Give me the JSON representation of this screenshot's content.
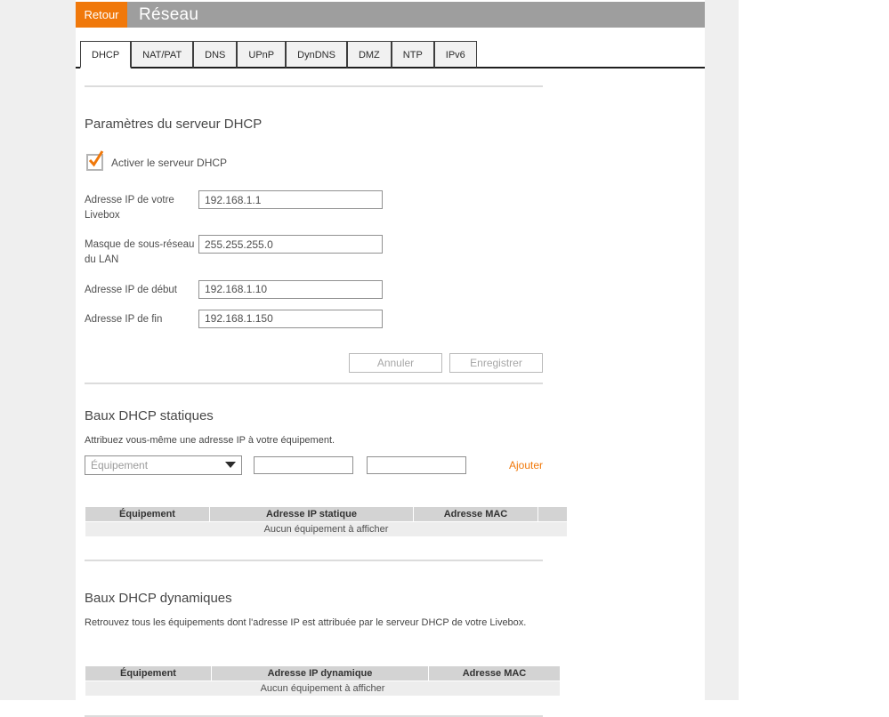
{
  "header": {
    "back_label": "Retour",
    "title": "Réseau"
  },
  "tabs": [
    {
      "label": "DHCP",
      "active": true
    },
    {
      "label": "NAT/PAT",
      "active": false
    },
    {
      "label": "DNS",
      "active": false
    },
    {
      "label": "UPnP",
      "active": false
    },
    {
      "label": "DynDNS",
      "active": false
    },
    {
      "label": "DMZ",
      "active": false
    },
    {
      "label": "NTP",
      "active": false
    },
    {
      "label": "IPv6",
      "active": false
    }
  ],
  "dhcp_settings": {
    "title": "Paramètres du serveur DHCP",
    "enable_label": "Activer le serveur DHCP",
    "enabled": true,
    "fields": [
      {
        "label": "Adresse IP de votre Livebox",
        "value": "192.168.1.1"
      },
      {
        "label": "Masque de sous-réseau du LAN",
        "value": "255.255.255.0"
      },
      {
        "label": "Adresse IP de début",
        "value": "192.168.1.10"
      },
      {
        "label": "Adresse IP de fin",
        "value": "192.168.1.150"
      }
    ],
    "cancel_label": "Annuler",
    "save_label": "Enregistrer"
  },
  "static_leases": {
    "title": "Baux DHCP statiques",
    "description": "Attribuez vous-même une adresse IP à votre équipement.",
    "device_select_value": "Équipement",
    "add_label": "Ajouter",
    "table": {
      "headers": [
        "Équipement",
        "Adresse IP statique",
        "Adresse MAC"
      ],
      "empty_message": "Aucun équipement à afficher"
    }
  },
  "dynamic_leases": {
    "title": "Baux DHCP dynamiques",
    "description": "Retrouvez tous les équipements dont l'adresse IP est attribuée par le serveur DHCP de votre Livebox.",
    "table": {
      "headers": [
        "Équipement",
        "Adresse IP dynamique",
        "Adresse MAC"
      ],
      "empty_message": "Aucun équipement à afficher"
    }
  },
  "colors": {
    "accent": "#f0780a",
    "header_gray": "#9e9e9e"
  }
}
